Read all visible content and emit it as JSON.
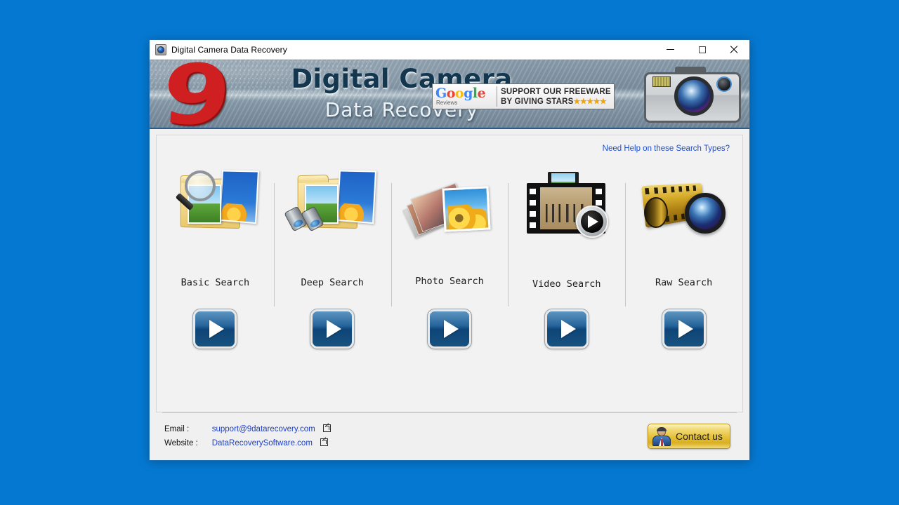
{
  "window": {
    "title": "Digital Camera Data Recovery",
    "icon": "camera-icon",
    "controls": {
      "minimize": "–",
      "maximize": "□",
      "close": "✕"
    }
  },
  "banner": {
    "logo_text": "9",
    "brand_line1": "Digital Camera",
    "brand_line2": "Data Recovery",
    "google_badge": {
      "google_b": "G",
      "google_o1": "o",
      "google_o2": "o",
      "google_g": "g",
      "google_l": "l",
      "google_e": "e",
      "reviews": "Reviews",
      "line1": "SUPPORT OUR FREEWARE",
      "line2": "BY GIVING STARS",
      "stars": "★★★★★"
    },
    "camera_icon": "camera-illustration"
  },
  "main": {
    "help_link": "Need Help on these Search Types?",
    "search_types": [
      {
        "label": "Basic Search",
        "icon": "folder-magnifier-icon",
        "button": "start-basic-search"
      },
      {
        "label": "Deep Search",
        "icon": "folder-binoculars-icon",
        "button": "start-deep-search"
      },
      {
        "label": "Photo Search",
        "icon": "photo-stack-icon",
        "button": "start-photo-search"
      },
      {
        "label": "Video Search",
        "icon": "film-play-icon",
        "button": "start-video-search"
      },
      {
        "label": "Raw Search",
        "icon": "film-reel-lens-icon",
        "button": "start-raw-search"
      }
    ]
  },
  "footer": {
    "email_label": "Email :",
    "email_value": "support@9datarecovery.com",
    "website_label": "Website :",
    "website_value": "DataRecoverySoftware.com",
    "contact_button": "Contact us"
  },
  "colors": {
    "desktop": "#0579d2",
    "link": "#1a3fd0",
    "help_link": "#1a4fd6",
    "accent_gold": "#e6c23c",
    "brand_dark": "#13374f",
    "logo_red": "#cf1f20"
  }
}
